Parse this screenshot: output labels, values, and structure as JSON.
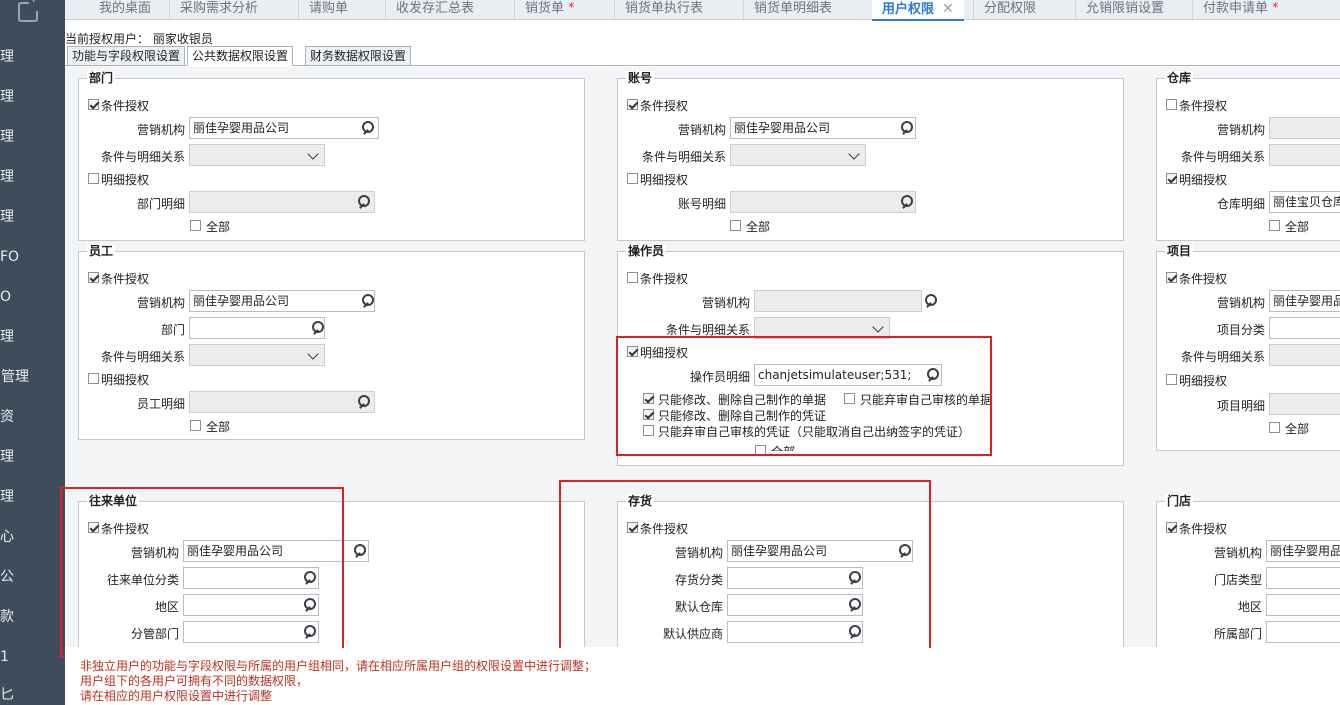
{
  "sidebar": {
    "items": [
      "理",
      "理",
      "理",
      "理",
      "理",
      "FO",
      "O",
      "理",
      "售管理",
      "资",
      "理",
      "理",
      "心",
      "公",
      "款",
      "1",
      "匕"
    ]
  },
  "tabs": [
    {
      "label": "我的桌面",
      "star": ""
    },
    {
      "label": "采购需求分析",
      "star": ""
    },
    {
      "label": "请购单",
      "star": ""
    },
    {
      "label": "收发存汇总表",
      "star": ""
    },
    {
      "label": "销货单",
      "star": "*"
    },
    {
      "label": "销货单执行表",
      "star": ""
    },
    {
      "label": "销货单明细表",
      "star": ""
    },
    {
      "label": "用户权限",
      "star": "",
      "close": "✕"
    },
    {
      "label": "分配权限",
      "star": ""
    },
    {
      "label": "允销限销设置",
      "star": ""
    },
    {
      "label": "付款申请单",
      "star": "*"
    }
  ],
  "current_user": "当前授权用户：  丽家收银员",
  "subtabs": [
    "功能与字段权限设置",
    "公共数据权限设置",
    "财务数据权限设置"
  ],
  "groups": {
    "dept": {
      "title": "部门",
      "cond": "条件授权",
      "org_label": "营销机构",
      "org_value": "丽佳孕婴用品公司",
      "rel_label": "条件与明细关系",
      "detail": "明细授权",
      "detail_label": "部门明细",
      "all": "全部"
    },
    "account": {
      "title": "账号",
      "cond": "条件授权",
      "org_label": "营销机构",
      "org_value": "丽佳孕婴用品公司",
      "rel_label": "条件与明细关系",
      "detail": "明细授权",
      "detail_label": "账号明细",
      "all": "全部"
    },
    "warehouse": {
      "title": "仓库",
      "cond": "条件授权",
      "org_label": "营销机构",
      "rel_label": "条件与明细关系",
      "detail": "明细授权",
      "detail_label": "仓库明细",
      "detail_value": "丽佳宝贝仓库",
      "all": "全部"
    },
    "employee": {
      "title": "员工",
      "cond": "条件授权",
      "org_label": "营销机构",
      "org_value": "丽佳孕婴用品公司",
      "dept_label": "部门",
      "rel_label": "条件与明细关系",
      "detail": "明细授权",
      "detail_label": "员工明细",
      "all": "全部"
    },
    "operator": {
      "title": "操作员",
      "cond": "条件授权",
      "org_label": "营销机构",
      "rel_label": "条件与明细关系",
      "detail": "明细授权",
      "detail_label": "操作员明细",
      "detail_value": "chanjetsimulateuser;531;",
      "opt1": "只能修改、删除自己制作的单据",
      "opt2": "只能弃审自己审核的单据",
      "opt3": "只能修改、删除自己制作的凭证",
      "opt4": "只能弃审自己审核的凭证（只能取消自己出纳签字的凭证）",
      "all": "全部"
    },
    "project": {
      "title": "项目",
      "cond": "条件授权",
      "org_label": "营销机构",
      "org_value": "丽佳孕婴用品",
      "cat_label": "项目分类",
      "rel_label": "条件与明细关系",
      "detail": "明细授权",
      "detail_label": "项目明细",
      "all": "全部"
    },
    "partner": {
      "title": "往来单位",
      "cond": "条件授权",
      "org_label": "营销机构",
      "org_value": "丽佳孕婴用品公司",
      "cat_label": "往来单位分类",
      "region_label": "地区",
      "dept_label": "分管部门"
    },
    "stock": {
      "title": "存货",
      "cond": "条件授权",
      "org_label": "营销机构",
      "org_value": "丽佳孕婴用品公司",
      "cat_label": "存货分类",
      "wh_label": "默认仓库",
      "sup_label": "默认供应商"
    },
    "store": {
      "title": "门店",
      "cond": "条件授权",
      "org_label": "营销机构",
      "org_value": "丽佳孕婴用品",
      "type_label": "门店类型",
      "region_label": "地区",
      "dept_label": "所属部门"
    }
  },
  "notes": [
    "非独立用户的功能与字段权限与所属的用户组相同，请在相应所属用户组的权限设置中进行调整；",
    "用户组下的各用户可拥有不同的数据权限，",
    "请在相应的用户权限设置中进行调整"
  ],
  "colors": {
    "active_tab": "#2b7bd8",
    "sidebar": "#3f4c5c",
    "highlight": "#e02020",
    "note": "#c03020"
  }
}
